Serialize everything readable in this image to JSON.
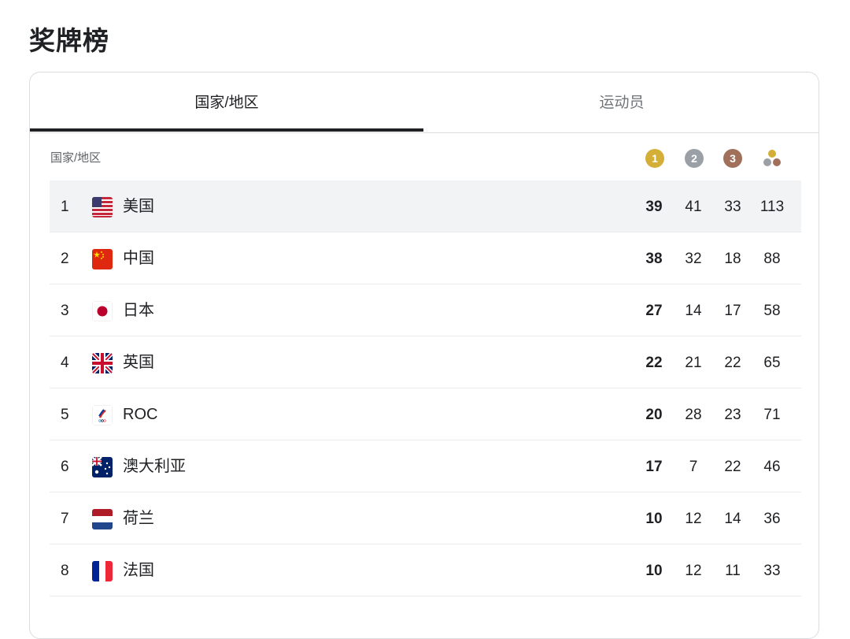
{
  "page_title": "奖牌榜",
  "tabs": [
    {
      "label": "国家/地区",
      "active": true
    },
    {
      "label": "运动员",
      "active": false
    }
  ],
  "table": {
    "header_label": "国家/地区",
    "medal_headers": {
      "gold": "1",
      "silver": "2",
      "bronze": "3"
    },
    "colors": {
      "gold": "#d4af37",
      "silver": "#9aa0a6",
      "bronze": "#a1705b"
    },
    "rows": [
      {
        "rank": "1",
        "country": "美国",
        "flag": "us-flag",
        "gold": "39",
        "silver": "41",
        "bronze": "33",
        "total": "113"
      },
      {
        "rank": "2",
        "country": "中国",
        "flag": "china-flag",
        "gold": "38",
        "silver": "32",
        "bronze": "18",
        "total": "88"
      },
      {
        "rank": "3",
        "country": "日本",
        "flag": "japan-flag",
        "gold": "27",
        "silver": "14",
        "bronze": "17",
        "total": "58"
      },
      {
        "rank": "4",
        "country": "英国",
        "flag": "uk-flag",
        "gold": "22",
        "silver": "21",
        "bronze": "22",
        "total": "65"
      },
      {
        "rank": "5",
        "country": "ROC",
        "flag": "roc-flag",
        "gold": "20",
        "silver": "28",
        "bronze": "23",
        "total": "71"
      },
      {
        "rank": "6",
        "country": "澳大利亚",
        "flag": "australia-flag",
        "gold": "17",
        "silver": "7",
        "bronze": "22",
        "total": "46"
      },
      {
        "rank": "7",
        "country": "荷兰",
        "flag": "netherlands-flag",
        "gold": "10",
        "silver": "12",
        "bronze": "14",
        "total": "36"
      },
      {
        "rank": "8",
        "country": "法国",
        "flag": "france-flag",
        "gold": "10",
        "silver": "12",
        "bronze": "11",
        "total": "33"
      }
    ]
  }
}
